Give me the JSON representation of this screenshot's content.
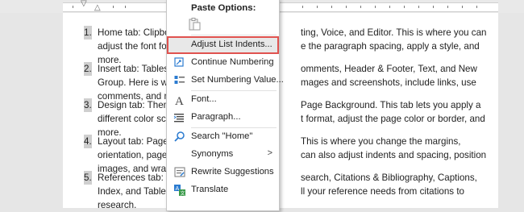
{
  "menu": {
    "paste_options_label": "Paste Options:",
    "items": [
      {
        "label": "Adjust List Indents...",
        "icon": "none",
        "highlighted": true
      },
      {
        "label": "Continue Numbering",
        "icon": "numbering-icon"
      },
      {
        "label": "Set Numbering Value...",
        "icon": "numbering-value-icon"
      },
      {
        "label": "Font...",
        "icon": "font-icon"
      },
      {
        "label": "Paragraph...",
        "icon": "paragraph-icon"
      },
      {
        "label": "Search \"Home\"",
        "icon": "search-icon"
      },
      {
        "label": "Synonyms",
        "icon": "none",
        "submenu": ">"
      },
      {
        "label": "Rewrite Suggestions",
        "icon": "rewrite-icon"
      },
      {
        "label": "Translate",
        "icon": "translate-icon"
      }
    ]
  },
  "document": {
    "items": [
      {
        "number": "1.",
        "lines": [
          "Home tab: Clipboa",
          "adjust the font for",
          "more."
        ],
        "right_lines": [
          "ting, Voice, and Editor. This is where you can",
          "e the paragraph spacing, apply a style, and"
        ]
      },
      {
        "number": "2.",
        "lines": [
          "Insert tab: Tables,",
          "Group. Here is wh",
          "comments, and mo"
        ],
        "right_lines": [
          "omments, Header & Footer, Text, and New",
          "mages and screenshots, include links, use"
        ]
      },
      {
        "number": "3.",
        "lines": [
          "Design tab: Theme",
          "different color sch",
          "more."
        ],
        "right_lines": [
          "Page Background. This tab lets you apply a",
          "t format, adjust the page color or border, and"
        ]
      },
      {
        "number": "4.",
        "lines": [
          "Layout tab: Page S",
          "orientation, page s",
          "images, and wrap t"
        ],
        "right_lines": [
          "This is where you change the margins,",
          "can also adjust indents and spacing, position"
        ]
      },
      {
        "number": "5.",
        "lines": [
          "References tab: Ta",
          "Index, and Table o",
          "research."
        ],
        "right_lines": [
          "search, Citations & Bibliography, Captions,",
          "ll your reference needs from citations to"
        ]
      }
    ]
  }
}
